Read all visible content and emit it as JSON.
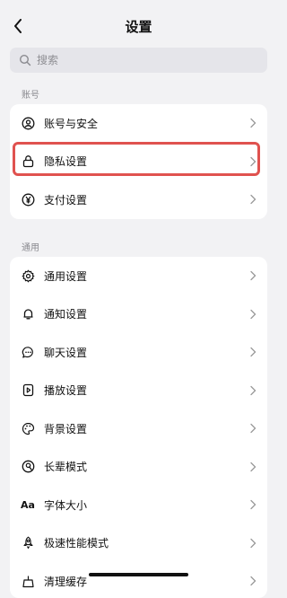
{
  "header": {
    "title": "设置"
  },
  "search": {
    "placeholder": "搜索"
  },
  "sections": [
    {
      "label": "账号",
      "items": [
        {
          "label": "账号与安全",
          "icon": "account-icon"
        },
        {
          "label": "隐私设置",
          "icon": "lock-icon",
          "highlighted": true
        },
        {
          "label": "支付设置",
          "icon": "yen-icon"
        }
      ]
    },
    {
      "label": "通用",
      "items": [
        {
          "label": "通用设置",
          "icon": "gear-icon"
        },
        {
          "label": "通知设置",
          "icon": "bell-icon"
        },
        {
          "label": "聊天设置",
          "icon": "chat-bubble-icon"
        },
        {
          "label": "播放设置",
          "icon": "play-icon"
        },
        {
          "label": "背景设置",
          "icon": "palette-icon"
        },
        {
          "label": "长辈模式",
          "icon": "elder-icon"
        },
        {
          "label": "字体大小",
          "icon": "font-size-icon",
          "icon_text": "Aa"
        },
        {
          "label": "极速性能模式",
          "icon": "rocket-icon"
        },
        {
          "label": "清理缓存",
          "icon": "broom-icon"
        }
      ]
    }
  ],
  "colors": {
    "highlight": "#e0524f",
    "background": "#f2f2f4"
  }
}
